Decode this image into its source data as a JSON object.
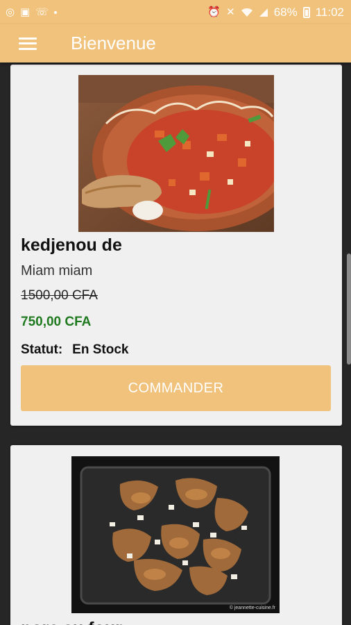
{
  "status_bar": {
    "battery": "68%",
    "time": "11:02",
    "icons_left": [
      "circle-icon",
      "image-icon",
      "missed-call-icon",
      "dot-icon"
    ],
    "icons_right": [
      "alarm-icon",
      "mute-icon",
      "wifi-icon",
      "signal-icon",
      "battery-icon"
    ]
  },
  "app_bar": {
    "title": "Bienvenue",
    "menu_icon": "hamburger-icon"
  },
  "colors": {
    "accent": "#f0c27b",
    "price_green": "#1f7a1f",
    "card_bg": "#f0f0f0",
    "background": "#262626"
  },
  "products": [
    {
      "title": "kedjenou de",
      "subtitle": "Miam miam",
      "old_price": "1500,00  CFA",
      "new_price": "750,00  CFA",
      "status_label": "Statut:",
      "status_value": "En Stock",
      "button": "COMMANDER"
    },
    {
      "title": "porc au four",
      "watermark": "© jeannette-cuisine.fr"
    }
  ]
}
